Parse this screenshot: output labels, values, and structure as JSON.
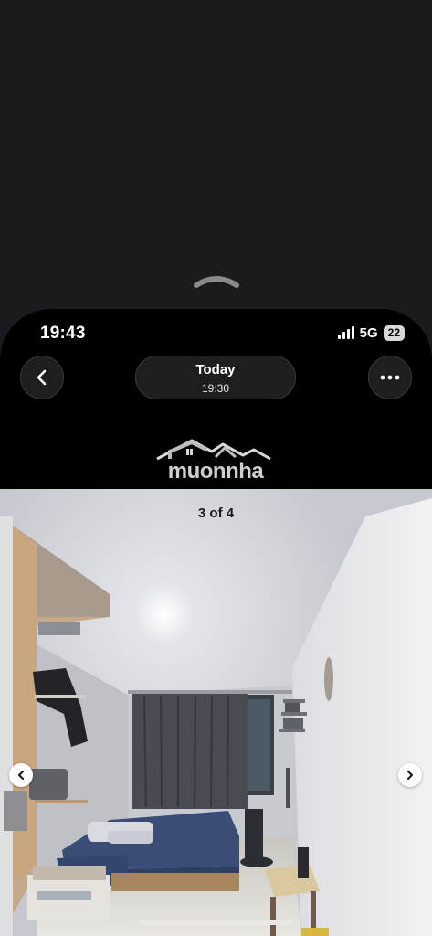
{
  "status_bar": {
    "time": "19:43",
    "network": "5G",
    "battery": "22",
    "icons": [
      "signal-icon",
      "battery-icon"
    ]
  },
  "header": {
    "date_title": "Today",
    "date_time": "19:30",
    "icons": [
      "chevron-left-icon",
      "ellipsis-icon",
      "chevron-up-icon"
    ]
  },
  "watermark": {
    "text": "muonnha"
  },
  "photo": {
    "counter": "3 of 4",
    "icons": [
      "chevron-left-icon",
      "chevron-right-icon"
    ]
  }
}
